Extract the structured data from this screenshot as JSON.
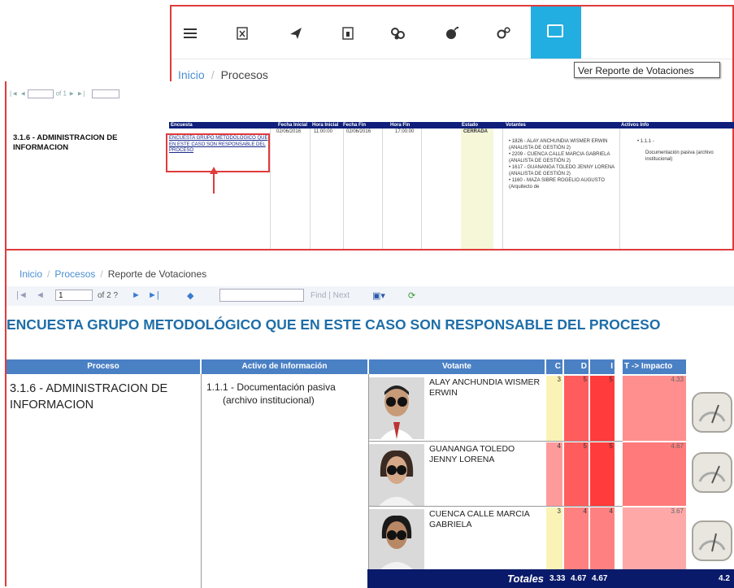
{
  "toolbar": {
    "icons": [
      "menu-icon",
      "excel-icon",
      "send-icon",
      "document-icon",
      "link-icon",
      "bomb-icon",
      "settings-icon",
      "report-icon"
    ],
    "active_icon": "report-icon"
  },
  "breadcrumb_top": {
    "home": "Inicio",
    "current": "Procesos"
  },
  "tooltip": "Ver Reporte de Votaciones",
  "mid_report": {
    "nav_of": "of 1",
    "headers": [
      "Encuesta",
      "Fecha Inicial",
      "Hora Inicial",
      "Fecha Fin",
      "Hora Fin",
      "Estado",
      "Votantes",
      "Activos Info"
    ],
    "proceso": "3.1.6 - ADMINISTRACION DE INFORMACION",
    "encuesta": "ENCUESTA GRUPO METODOLÓGICO QUE EN ESTE CASO SON RESPONSABLE DEL PROCESO",
    "fecha_inicial": "02/06/2016",
    "hora_inicial": "11:00:00",
    "fecha_fin": "02/06/2016",
    "hora_fin": "17:00:00",
    "estado": "CERRADA",
    "votantes": [
      "1826 - ALAY ANCHUNDIA WISMER ERWIN (ANALISTA DE GESTIÓN 2)",
      "2209 - CUENCA CALLE MARCIA GABRIELA (ANALISTA DE GESTIÓN 2)",
      "1617 - GUANANGA TOLEDO JENNY LORENA (ANALISTA DE GESTIÓN 2)",
      "1160 - MAZA SIBRE ROGELIO AUGUSTO (Arquitecto de"
    ],
    "activo_code": "1.1.1 -",
    "activo_desc": "Documentación pasiva (archivo institucional)"
  },
  "breadcrumb_bottom": {
    "home": "Inicio",
    "mid": "Procesos",
    "current": "Reporte de Votaciones"
  },
  "report_nav": {
    "page": "1",
    "of": "of 2 ?",
    "find": "Find",
    "sep": "|",
    "next": "Next"
  },
  "report": {
    "title": "ENCUESTA GRUPO METODOLÓGICO QUE EN ESTE CASO SON RESPONSABLE DEL PROCESO",
    "headers": {
      "proceso": "Proceso",
      "activo": "Activo de Información",
      "votante": "Votante",
      "c": "C",
      "d": "D",
      "i": "I",
      "t": "T -> Impacto"
    },
    "proceso": "3.1.6 - ADMINISTRACION DE INFORMACION",
    "activo_line1": "1.1.1 - Documentación pasiva",
    "activo_line2": "(archivo institucional)",
    "rows": [
      {
        "voter": "ALAY ANCHUNDIA WISMER ERWIN",
        "c": "3",
        "d": "5",
        "i": "5",
        "t": "4.33"
      },
      {
        "voter": "GUANANGA TOLEDO JENNY LORENA",
        "c": "4",
        "d": "5",
        "i": "5",
        "t": "4.67"
      },
      {
        "voter": "CUENCA CALLE MARCIA GABRIELA",
        "c": "3",
        "d": "4",
        "i": "4",
        "t": "3.67"
      }
    ],
    "totals": {
      "label": "Totales",
      "c": "3.33",
      "d": "4.67",
      "i": "4.67",
      "t": "4.2"
    },
    "colors": {
      "header": "#4a80c4",
      "title": "#1f6ea8",
      "totals_bg": "#0a1a6a",
      "c_cell": "#fbf3b6",
      "d_cell": "#ff5d5d",
      "i_cell": "#ff3b3b",
      "t_cell": "#ff8e8e"
    }
  }
}
